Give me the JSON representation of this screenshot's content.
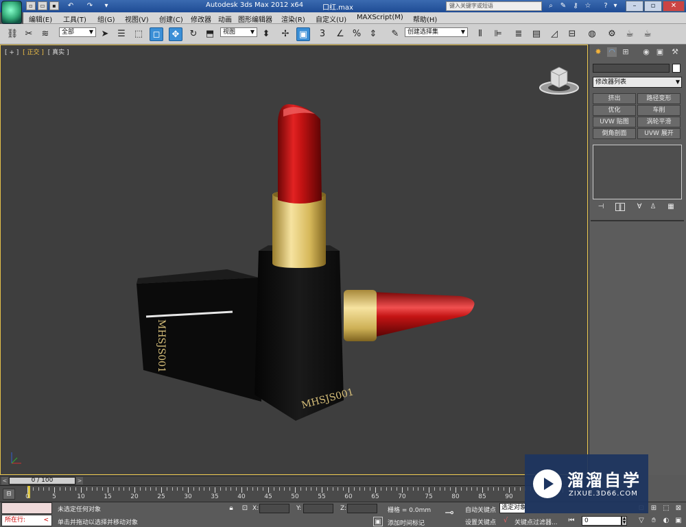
{
  "titlebar": {
    "title": "Autodesk 3ds Max  2012 x64",
    "file": "口红.max",
    "search_placeholder": "键入关键字或短语",
    "icons": [
      "open-icon",
      "new-icon",
      "save-icon",
      "undo-icon",
      "redo-icon",
      "binoculars-icon",
      "wrench-icon",
      "key-icon",
      "star-icon",
      "help-icon"
    ]
  },
  "menubar": {
    "items": [
      "编辑(E)",
      "工具(T)",
      "组(G)",
      "视图(V)",
      "创建(C)",
      "修改器",
      "动画",
      "图形编辑器",
      "渲染(R)",
      "自定义(U)",
      "MAXScript(M)",
      "帮助(H)"
    ]
  },
  "toolbar": {
    "selection_filter": "全部",
    "reference_coord": "视图",
    "named_selection": "创建选择集",
    "active_tools": [
      "select-region",
      "select-move"
    ]
  },
  "viewport": {
    "label": [
      "[ + ]",
      "[ 正交 ]",
      "[ 真实 ]"
    ],
    "background": "#3e3e3e",
    "border_color": "#e6c24a",
    "scene_text_1": "MHSJS001",
    "scene_text_2": "MHSJS001",
    "lipstick_color": "#c41414",
    "gold_color": "#e0c56a"
  },
  "command_panel": {
    "modifier_list": "修改器列表",
    "buttons": [
      "挤出",
      "路径变形",
      "优化",
      "车削",
      "UVW 贴图",
      "涡轮平滑",
      "倒角剖面",
      "UVW 展开"
    ],
    "tabs": [
      "create-icon",
      "modify-icon",
      "hierarchy-icon",
      "motion-icon",
      "display-icon",
      "utilities-icon"
    ]
  },
  "timeline": {
    "position": "0 / 100",
    "ticks": [
      0,
      5,
      10,
      15,
      20,
      25,
      30,
      35,
      40,
      45,
      50,
      55,
      60,
      65,
      70,
      75,
      80,
      85,
      90
    ]
  },
  "status": {
    "location": "所在行:",
    "selection": "未选定任何对象",
    "prompt": "单击并拖动以选择并移动对象",
    "x_label": "X:",
    "y_label": "Y:",
    "z_label": "Z:",
    "grid": "栅格 = 0.0mm",
    "add_time_tag": "添加时间标记",
    "auto_key": "自动关键点",
    "set_key": "设置关键点",
    "selection_set": "选定对象",
    "key_filters": "关键点过滤器...",
    "frame": "0"
  },
  "watermark": {
    "title": "溜溜自学",
    "url": "ZIXUE.3D66.COM"
  }
}
